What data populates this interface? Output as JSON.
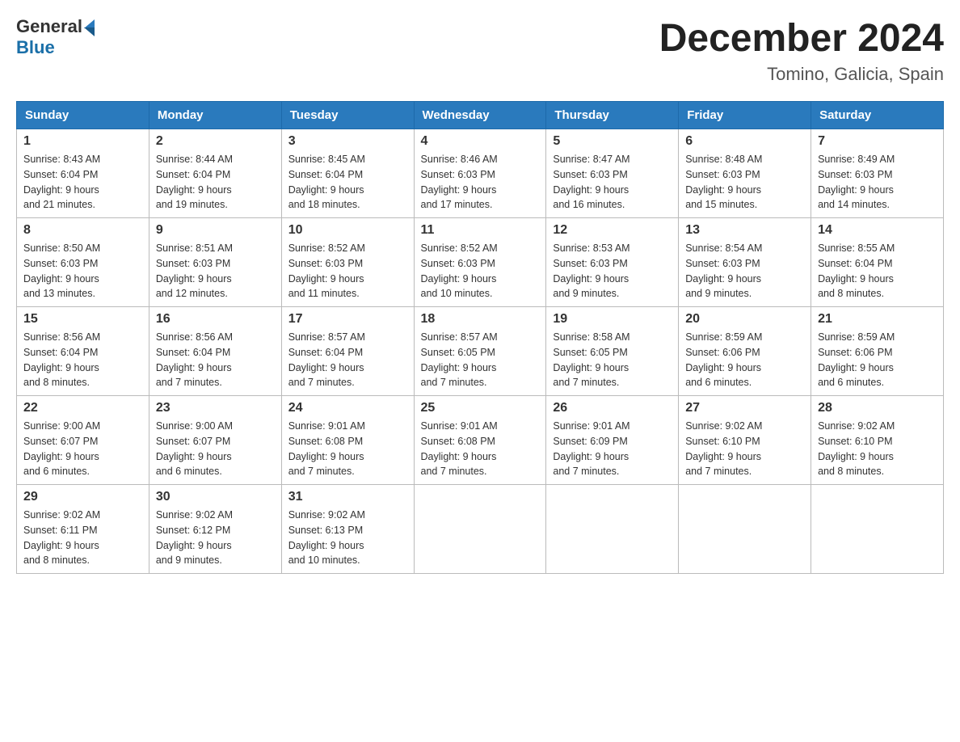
{
  "logo": {
    "text_general": "General",
    "text_blue": "Blue"
  },
  "title": "December 2024",
  "subtitle": "Tomino, Galicia, Spain",
  "days_of_week": [
    "Sunday",
    "Monday",
    "Tuesday",
    "Wednesday",
    "Thursday",
    "Friday",
    "Saturday"
  ],
  "weeks": [
    [
      {
        "day": "1",
        "sunrise": "8:43 AM",
        "sunset": "6:04 PM",
        "daylight": "9 hours and 21 minutes."
      },
      {
        "day": "2",
        "sunrise": "8:44 AM",
        "sunset": "6:04 PM",
        "daylight": "9 hours and 19 minutes."
      },
      {
        "day": "3",
        "sunrise": "8:45 AM",
        "sunset": "6:04 PM",
        "daylight": "9 hours and 18 minutes."
      },
      {
        "day": "4",
        "sunrise": "8:46 AM",
        "sunset": "6:03 PM",
        "daylight": "9 hours and 17 minutes."
      },
      {
        "day": "5",
        "sunrise": "8:47 AM",
        "sunset": "6:03 PM",
        "daylight": "9 hours and 16 minutes."
      },
      {
        "day": "6",
        "sunrise": "8:48 AM",
        "sunset": "6:03 PM",
        "daylight": "9 hours and 15 minutes."
      },
      {
        "day": "7",
        "sunrise": "8:49 AM",
        "sunset": "6:03 PM",
        "daylight": "9 hours and 14 minutes."
      }
    ],
    [
      {
        "day": "8",
        "sunrise": "8:50 AM",
        "sunset": "6:03 PM",
        "daylight": "9 hours and 13 minutes."
      },
      {
        "day": "9",
        "sunrise": "8:51 AM",
        "sunset": "6:03 PM",
        "daylight": "9 hours and 12 minutes."
      },
      {
        "day": "10",
        "sunrise": "8:52 AM",
        "sunset": "6:03 PM",
        "daylight": "9 hours and 11 minutes."
      },
      {
        "day": "11",
        "sunrise": "8:52 AM",
        "sunset": "6:03 PM",
        "daylight": "9 hours and 10 minutes."
      },
      {
        "day": "12",
        "sunrise": "8:53 AM",
        "sunset": "6:03 PM",
        "daylight": "9 hours and 9 minutes."
      },
      {
        "day": "13",
        "sunrise": "8:54 AM",
        "sunset": "6:03 PM",
        "daylight": "9 hours and 9 minutes."
      },
      {
        "day": "14",
        "sunrise": "8:55 AM",
        "sunset": "6:04 PM",
        "daylight": "9 hours and 8 minutes."
      }
    ],
    [
      {
        "day": "15",
        "sunrise": "8:56 AM",
        "sunset": "6:04 PM",
        "daylight": "9 hours and 8 minutes."
      },
      {
        "day": "16",
        "sunrise": "8:56 AM",
        "sunset": "6:04 PM",
        "daylight": "9 hours and 7 minutes."
      },
      {
        "day": "17",
        "sunrise": "8:57 AM",
        "sunset": "6:04 PM",
        "daylight": "9 hours and 7 minutes."
      },
      {
        "day": "18",
        "sunrise": "8:57 AM",
        "sunset": "6:05 PM",
        "daylight": "9 hours and 7 minutes."
      },
      {
        "day": "19",
        "sunrise": "8:58 AM",
        "sunset": "6:05 PM",
        "daylight": "9 hours and 7 minutes."
      },
      {
        "day": "20",
        "sunrise": "8:59 AM",
        "sunset": "6:06 PM",
        "daylight": "9 hours and 6 minutes."
      },
      {
        "day": "21",
        "sunrise": "8:59 AM",
        "sunset": "6:06 PM",
        "daylight": "9 hours and 6 minutes."
      }
    ],
    [
      {
        "day": "22",
        "sunrise": "9:00 AM",
        "sunset": "6:07 PM",
        "daylight": "9 hours and 6 minutes."
      },
      {
        "day": "23",
        "sunrise": "9:00 AM",
        "sunset": "6:07 PM",
        "daylight": "9 hours and 6 minutes."
      },
      {
        "day": "24",
        "sunrise": "9:01 AM",
        "sunset": "6:08 PM",
        "daylight": "9 hours and 7 minutes."
      },
      {
        "day": "25",
        "sunrise": "9:01 AM",
        "sunset": "6:08 PM",
        "daylight": "9 hours and 7 minutes."
      },
      {
        "day": "26",
        "sunrise": "9:01 AM",
        "sunset": "6:09 PM",
        "daylight": "9 hours and 7 minutes."
      },
      {
        "day": "27",
        "sunrise": "9:02 AM",
        "sunset": "6:10 PM",
        "daylight": "9 hours and 7 minutes."
      },
      {
        "day": "28",
        "sunrise": "9:02 AM",
        "sunset": "6:10 PM",
        "daylight": "9 hours and 8 minutes."
      }
    ],
    [
      {
        "day": "29",
        "sunrise": "9:02 AM",
        "sunset": "6:11 PM",
        "daylight": "9 hours and 8 minutes."
      },
      {
        "day": "30",
        "sunrise": "9:02 AM",
        "sunset": "6:12 PM",
        "daylight": "9 hours and 9 minutes."
      },
      {
        "day": "31",
        "sunrise": "9:02 AM",
        "sunset": "6:13 PM",
        "daylight": "9 hours and 10 minutes."
      },
      null,
      null,
      null,
      null
    ]
  ],
  "labels": {
    "sunrise": "Sunrise:",
    "sunset": "Sunset:",
    "daylight": "Daylight:"
  }
}
